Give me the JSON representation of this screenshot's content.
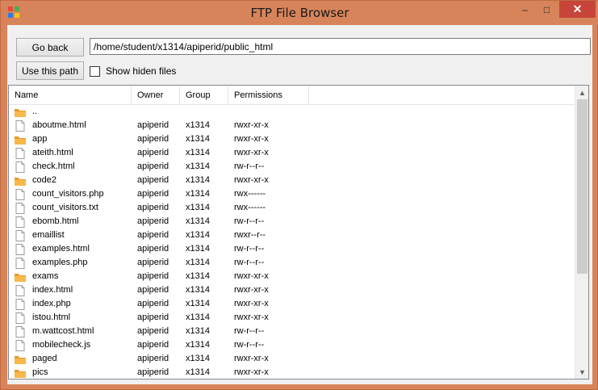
{
  "window": {
    "title": "FTP File Browser",
    "min_glyph": "–",
    "max_glyph": "□",
    "close_glyph": "✕"
  },
  "toolbar": {
    "go_back_label": "Go back",
    "use_path_label": "Use this path",
    "path_value": "/home/student/x1314/apiperid/public_html",
    "show_hidden_label": "Show hiden files",
    "show_hidden_checked": false
  },
  "list": {
    "columns": [
      "Name",
      "Owner",
      "Group",
      "Permissions"
    ],
    "rows": [
      {
        "name": "..",
        "owner": "",
        "group": "",
        "permissions": "",
        "icon": "folder-icon"
      },
      {
        "name": "aboutme.html",
        "owner": "apiperid",
        "group": "x1314",
        "permissions": "rwxr-xr-x",
        "icon": "file-icon"
      },
      {
        "name": "app",
        "owner": "apiperid",
        "group": "x1314",
        "permissions": "rwxr-xr-x",
        "icon": "folder-icon"
      },
      {
        "name": "ateith.html",
        "owner": "apiperid",
        "group": "x1314",
        "permissions": "rwxr-xr-x",
        "icon": "file-icon"
      },
      {
        "name": "check.html",
        "owner": "apiperid",
        "group": "x1314",
        "permissions": "rw-r--r--",
        "icon": "file-icon"
      },
      {
        "name": "code2",
        "owner": "apiperid",
        "group": "x1314",
        "permissions": "rwxr-xr-x",
        "icon": "folder-icon"
      },
      {
        "name": "count_visitors.php",
        "owner": "apiperid",
        "group": "x1314",
        "permissions": "rwx------",
        "icon": "file-icon"
      },
      {
        "name": "count_visitors.txt",
        "owner": "apiperid",
        "group": "x1314",
        "permissions": "rwx------",
        "icon": "file-icon"
      },
      {
        "name": "ebomb.html",
        "owner": "apiperid",
        "group": "x1314",
        "permissions": "rw-r--r--",
        "icon": "file-icon"
      },
      {
        "name": "emaillist",
        "owner": "apiperid",
        "group": "x1314",
        "permissions": "rwxr--r--",
        "icon": "file-icon"
      },
      {
        "name": "examples.html",
        "owner": "apiperid",
        "group": "x1314",
        "permissions": "rw-r--r--",
        "icon": "file-icon"
      },
      {
        "name": "examples.php",
        "owner": "apiperid",
        "group": "x1314",
        "permissions": "rw-r--r--",
        "icon": "file-icon"
      },
      {
        "name": "exams",
        "owner": "apiperid",
        "group": "x1314",
        "permissions": "rwxr-xr-x",
        "icon": "folder-icon"
      },
      {
        "name": "index.html",
        "owner": "apiperid",
        "group": "x1314",
        "permissions": "rwxr-xr-x",
        "icon": "file-icon"
      },
      {
        "name": "index.php",
        "owner": "apiperid",
        "group": "x1314",
        "permissions": "rwxr-xr-x",
        "icon": "file-icon"
      },
      {
        "name": "istou.html",
        "owner": "apiperid",
        "group": "x1314",
        "permissions": "rwxr-xr-x",
        "icon": "file-icon"
      },
      {
        "name": "m.wattcost.html",
        "owner": "apiperid",
        "group": "x1314",
        "permissions": "rw-r--r--",
        "icon": "file-icon"
      },
      {
        "name": "mobilecheck.js",
        "owner": "apiperid",
        "group": "x1314",
        "permissions": "rw-r--r--",
        "icon": "file-icon"
      },
      {
        "name": "paged",
        "owner": "apiperid",
        "group": "x1314",
        "permissions": "rwxr-xr-x",
        "icon": "folder-icon"
      },
      {
        "name": "pics",
        "owner": "apiperid",
        "group": "x1314",
        "permissions": "rwxr-xr-x",
        "icon": "folder-icon"
      }
    ]
  },
  "scrollbar": {
    "up_glyph": "▲",
    "down_glyph": "▼"
  },
  "colors": {
    "frame": "#d8845a",
    "close_button": "#c7443a",
    "folder": "#f0a030",
    "client": "#f0f0f0"
  }
}
